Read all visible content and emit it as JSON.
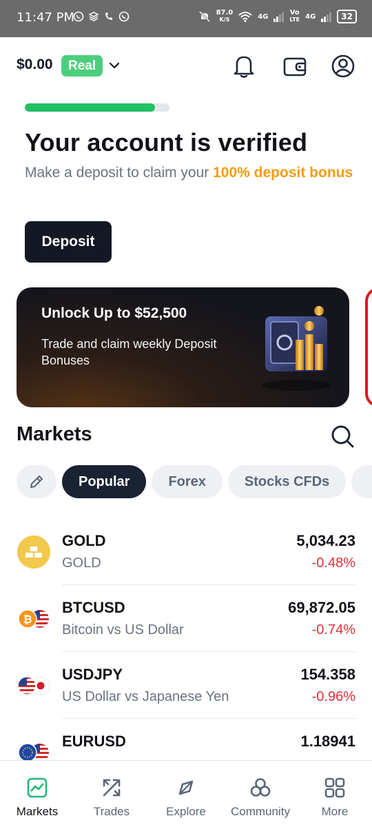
{
  "status_bar": {
    "time": "11:47 PM",
    "net_speed_value": "87.0",
    "net_speed_unit": "K/S",
    "net1": "4G",
    "volte_top": "Vo",
    "volte_bottom": "LTE",
    "net2": "4G",
    "battery": "32"
  },
  "header": {
    "balance": "$0.00",
    "account_type": "Real"
  },
  "verification": {
    "progress_percent": 90,
    "title": "Your account is verified",
    "subtitle_prefix": "Make a deposit to claim your ",
    "subtitle_highlight": "100% deposit bonus",
    "deposit_label": "Deposit"
  },
  "promo": {
    "title": "Unlock Up to $52,500",
    "text": "Trade and claim weekly Deposit Bonuses"
  },
  "markets": {
    "title": "Markets",
    "chips": [
      {
        "label": "Popular",
        "active": true
      },
      {
        "label": "Forex",
        "active": false
      },
      {
        "label": "Stocks CFDs",
        "active": false
      }
    ],
    "items": [
      {
        "symbol": "GOLD",
        "name": "GOLD",
        "price": "5,034.23",
        "change": "-0.48%",
        "icon": "gold-bars-icon"
      },
      {
        "symbol": "BTCUSD",
        "name": "Bitcoin vs US Dollar",
        "price": "69,872.05",
        "change": "-0.74%",
        "icon": "bitcoin-usd-flag-icon"
      },
      {
        "symbol": "USDJPY",
        "name": "US Dollar vs Japanese Yen",
        "price": "154.358",
        "change": "-0.96%",
        "icon": "usd-jpy-flag-icon"
      },
      {
        "symbol": "EURUSD",
        "name": "",
        "price": "1.18941",
        "change": "",
        "icon": "eur-usd-flag-icon"
      }
    ]
  },
  "bottom_nav": [
    {
      "label": "Markets",
      "icon": "chart-icon",
      "active": true
    },
    {
      "label": "Trades",
      "icon": "arrows-icon",
      "active": false
    },
    {
      "label": "Explore",
      "icon": "compass-icon",
      "active": false
    },
    {
      "label": "Community",
      "icon": "community-icon",
      "active": false
    },
    {
      "label": "More",
      "icon": "grid-icon",
      "active": false
    }
  ],
  "colors": {
    "accent_green": "#22c063",
    "badge_green": "#4ccf7d",
    "bonus_orange": "#f39c12",
    "negative_red": "#e0303a",
    "dark_button": "#141824"
  }
}
